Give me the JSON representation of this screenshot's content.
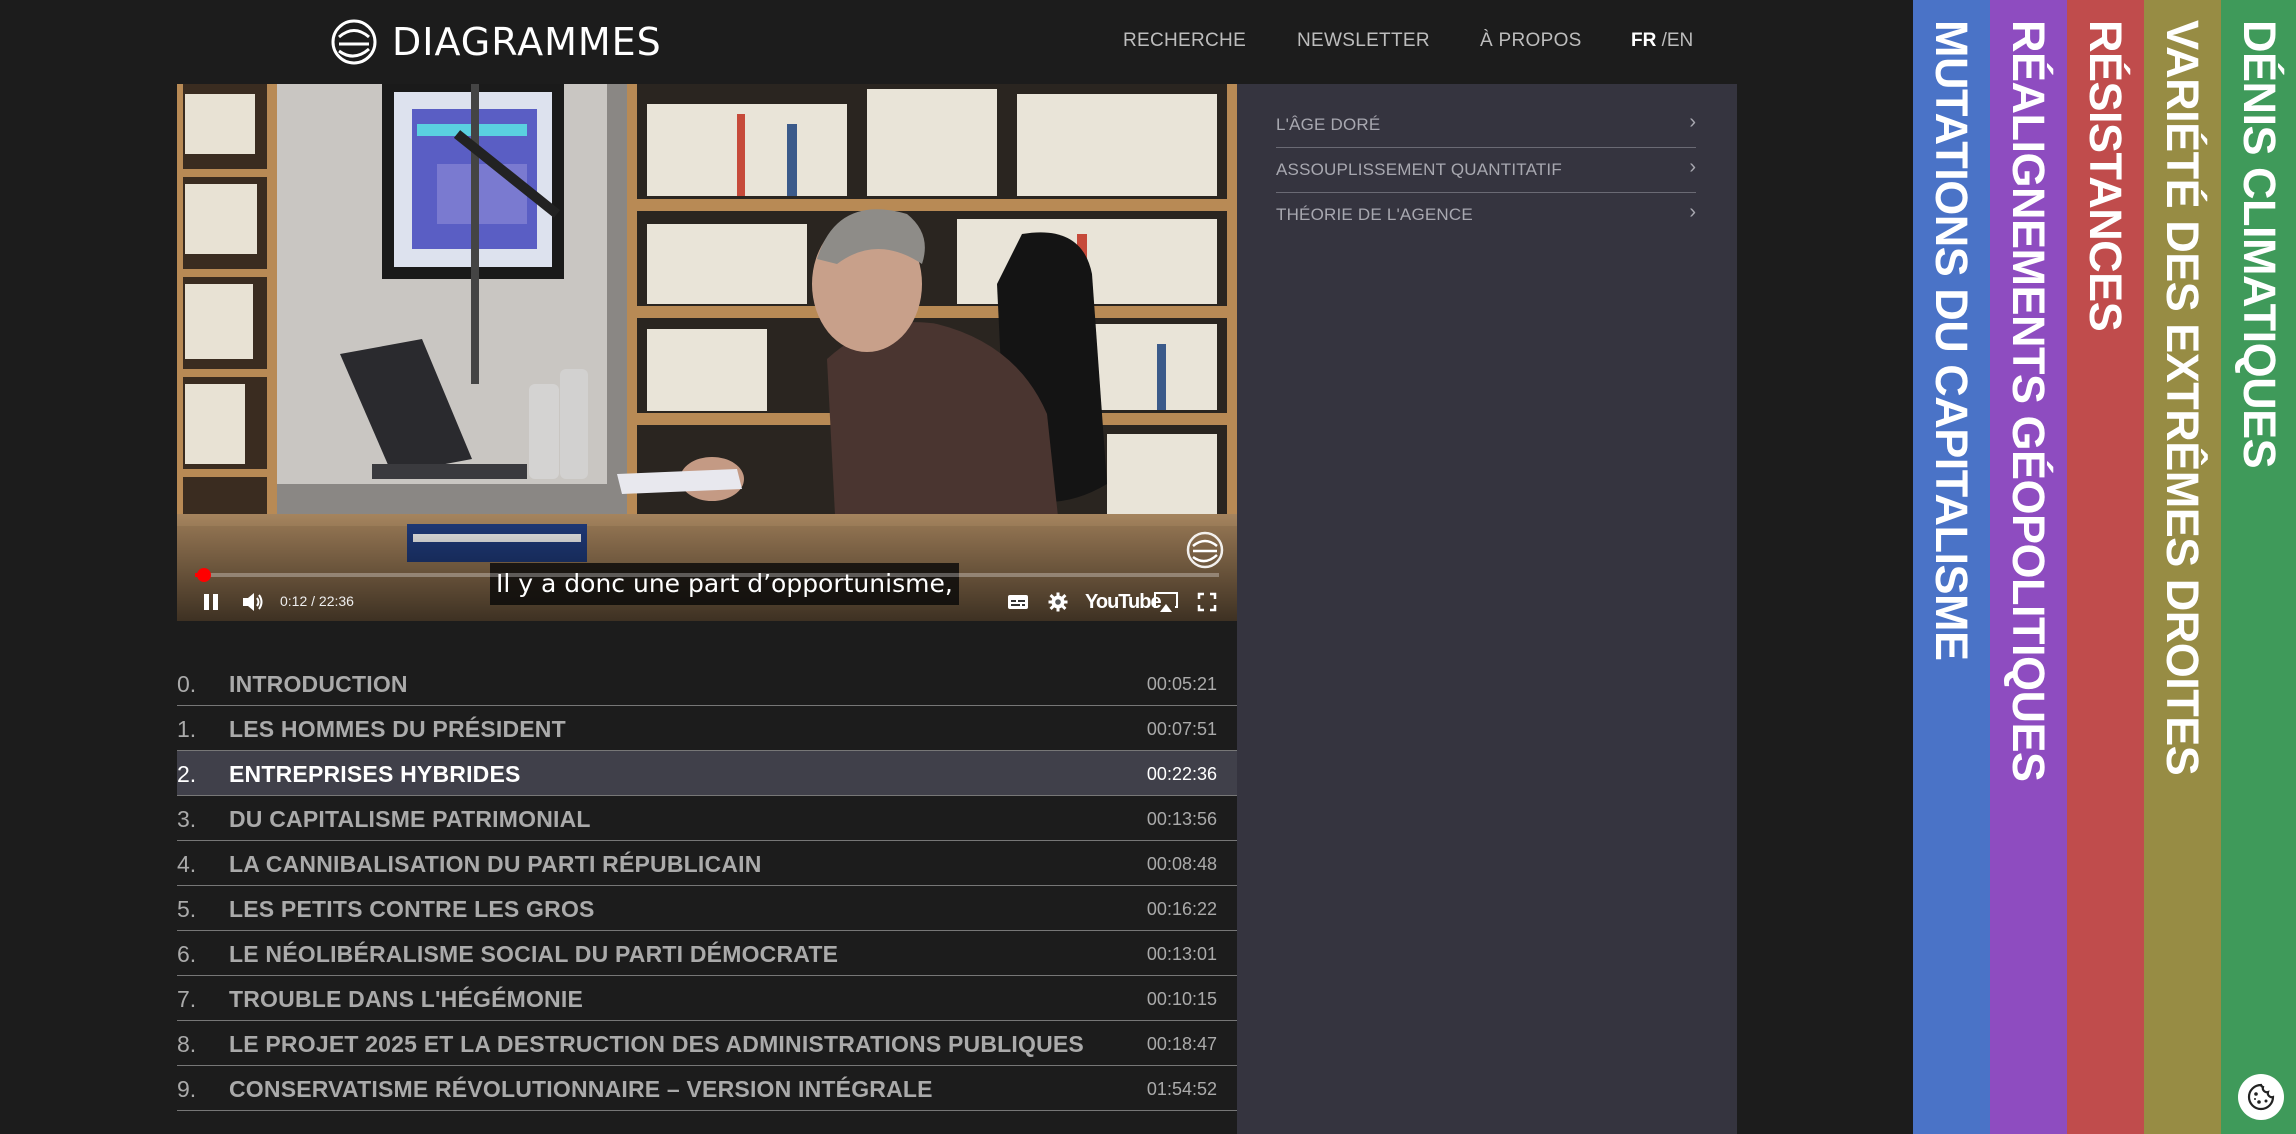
{
  "header": {
    "logo_text": "DIAGRAMMES",
    "nav": {
      "search": "RECHERCHE",
      "newsletter": "NEWSLETTER",
      "about": "À PROPOS"
    },
    "lang_fr": "FR",
    "lang_en": "/EN"
  },
  "video": {
    "subtitle": "Il y a donc une part d’opportunisme,",
    "time": "0:12 / 22:36",
    "progress_fraction": 0.009,
    "youtube_label": "YouTube",
    "icons": [
      "pause-icon",
      "volume-icon",
      "subtitles-icon",
      "settings-icon",
      "airplay-icon",
      "fullscreen-icon"
    ]
  },
  "chapters": [
    {
      "num": "0.",
      "title": "INTRODUCTION",
      "duration": "00:05:21",
      "active": false
    },
    {
      "num": "1.",
      "title": "LES HOMMES DU PRÉSIDENT",
      "duration": "00:07:51",
      "active": false
    },
    {
      "num": "2.",
      "title": "ENTREPRISES HYBRIDES",
      "duration": "00:22:36",
      "active": true
    },
    {
      "num": "3.",
      "title": "DU CAPITALISME PATRIMONIAL",
      "duration": "00:13:56",
      "active": false
    },
    {
      "num": "4.",
      "title": "LA CANNIBALISATION DU PARTI RÉPUBLICAIN",
      "duration": "00:08:48",
      "active": false
    },
    {
      "num": "5.",
      "title": "LES PETITS CONTRE LES GROS",
      "duration": "00:16:22",
      "active": false
    },
    {
      "num": "6.",
      "title": "LE NÉOLIBÉRALISME SOCIAL DU PARTI DÉMOCRATE",
      "duration": "00:13:01",
      "active": false
    },
    {
      "num": "7.",
      "title": "TROUBLE DANS L'HÉGÉMONIE",
      "duration": "00:10:15",
      "active": false
    },
    {
      "num": "8.",
      "title": "LE PROJET 2025 ET LA DESTRUCTION DES ADMINISTRATIONS PUBLIQUES",
      "duration": "00:18:47",
      "active": false
    },
    {
      "num": "9.",
      "title": "CONSERVATISME RÉVOLUTIONNAIRE – VERSION INTÉGRALE",
      "duration": "01:54:52",
      "active": false
    }
  ],
  "panel": {
    "items": [
      {
        "label": "L'ÂGE DORÉ",
        "chevron": "›"
      },
      {
        "label": "ASSOUPLISSEMENT QUANTITATIF",
        "chevron": "›"
      },
      {
        "label": "THÉORIE DE L'AGENCE",
        "chevron": "›"
      }
    ]
  },
  "tabs": [
    {
      "label": "MUTATIONS DU CAPITALISME",
      "color": "#4a73c7"
    },
    {
      "label": "RÉALIGNEMENTS GÉOPOLITIQUES",
      "color": "#8e4cc0"
    },
    {
      "label": "RÉSISTANCES",
      "color": "#c04c4c"
    },
    {
      "label": "VARIÉTÉ DES EXTRÊMES DROITES",
      "color": "#978c44"
    },
    {
      "label": "DÉNIS CLIMATIQUES",
      "color": "#3f9a5a"
    }
  ],
  "colors": {
    "background": "#1c1c1c",
    "panel": "#35343f",
    "active_row": "#40404a",
    "progress": "#ff0000"
  }
}
